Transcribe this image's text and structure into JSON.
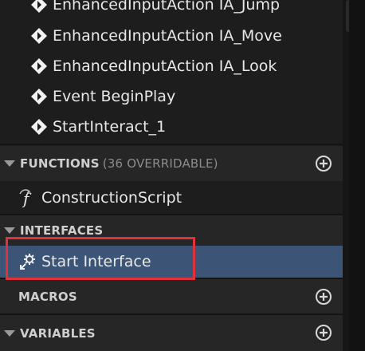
{
  "event_graph_items": [
    {
      "label": "EnhancedInputAction IA_Jump"
    },
    {
      "label": "EnhancedInputAction IA_Move"
    },
    {
      "label": "EnhancedInputAction IA_Look"
    },
    {
      "label": "Event BeginPlay"
    },
    {
      "label": "StartInteract_1"
    }
  ],
  "functions": {
    "title": "FUNCTIONS",
    "subtitle": "(36 OVERRIDABLE)",
    "items": [
      {
        "label": "ConstructionScript",
        "icon": "function-icon"
      }
    ]
  },
  "interfaces": {
    "title": "INTERFACES",
    "items": [
      {
        "label": "Start Interface",
        "icon": "interface-gear-icon",
        "selected": true
      }
    ]
  },
  "macros": {
    "title": "MACROS"
  },
  "variables": {
    "title": "VARIABLES"
  },
  "colors": {
    "selection": "#3c5576",
    "highlight_box": "#e0323a",
    "section_bg": "#262626",
    "panel_bg": "#1d1d1d"
  }
}
